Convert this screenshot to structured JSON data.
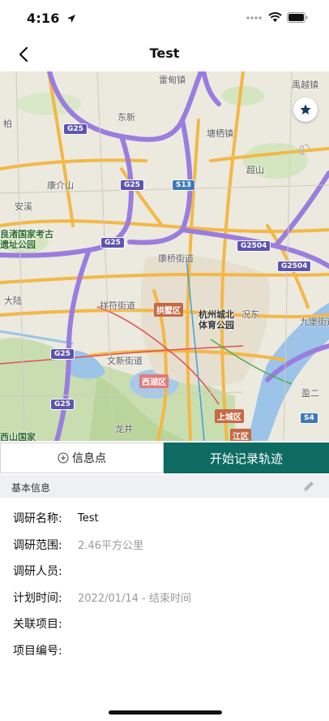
{
  "status_bar": {
    "time": "4:16"
  },
  "nav": {
    "title": "Test",
    "back_icon": "chevron-left-icon"
  },
  "map": {
    "labels": {
      "leiping": "雷甸镇",
      "gaoqiao": "禹越镇",
      "dongxin": "东新",
      "tangqi": "塘栖镇",
      "kangqian": "康介山",
      "anxi": "安溪",
      "chaoshan": "超山",
      "liangzhu": "良渚国家考古",
      "liangzhu2": "遗址公园",
      "kangqiao": "康桥街道",
      "dalu": "大陆",
      "xiangfu": "祥符街道",
      "gongshu": "拱墅区",
      "olympic": "杭州城北",
      "olympic2": "体育公园",
      "wenxin": "文新街道",
      "xihu": "西湖区",
      "shangcheng": "上城区",
      "longjing": "龙井",
      "xishan": "西山国家",
      "jiangqu": "江区",
      "bai": "柏",
      "jiuqiao": "九堡街道",
      "kuangfang": "况东",
      "yan": "盈二"
    },
    "shields": {
      "g25a": "G25",
      "g25b": "G25",
      "g25c": "G25",
      "g25d": "G25",
      "g25e": "G25",
      "s13": "S13",
      "g2504a": "G2504",
      "g2504b": "G2504",
      "s4": "S4"
    },
    "favorite_icon": "star-icon",
    "track_icon": "footprint-icon"
  },
  "actions": {
    "poi_label": "信息点",
    "poi_icon": "plus-circle-icon",
    "record_label": "开始记录轨迹"
  },
  "section": {
    "title": "基本信息",
    "edit_icon": "pencil-icon"
  },
  "info": {
    "name_label": "调研名称:",
    "name_value": "Test",
    "range_label": "调研范围:",
    "range_value": "2.46平方公里",
    "people_label": "调研人员:",
    "people_value": "",
    "time_label": "计划时间:",
    "time_value": "2022/01/14 - 结束时间",
    "project_label": "关联项目:",
    "project_value": "",
    "number_label": "项目编号:",
    "number_value": ""
  },
  "colors": {
    "primary": "#0d6b63",
    "highway": "#9a7ddf",
    "arterial": "#f3b845",
    "water": "#9cc3e8",
    "green": "#c8deb0"
  }
}
